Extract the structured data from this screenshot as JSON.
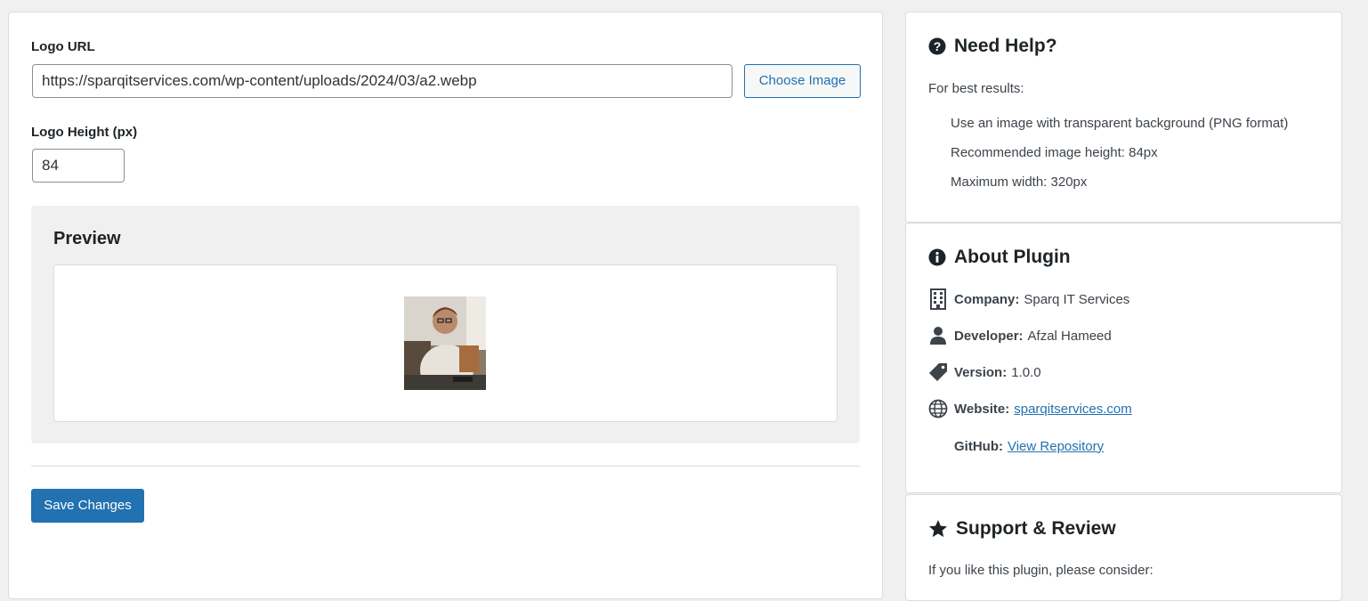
{
  "main": {
    "logo_url_label": "Logo URL",
    "logo_url_value": "https://sparqitservices.com/wp-content/uploads/2024/03/a2.webp",
    "choose_image_label": "Choose Image",
    "logo_height_label": "Logo Height (px)",
    "logo_height_value": "84",
    "preview_title": "Preview",
    "save_label": "Save Changes"
  },
  "help": {
    "title": "Need Help?",
    "icon": "question-circle-icon",
    "intro": "For best results:",
    "tips": [
      "Use an image with transparent background (PNG format)",
      "Recommended image height: 84px",
      "Maximum width: 320px"
    ]
  },
  "about": {
    "title": "About Plugin",
    "icon": "info-circle-icon",
    "company_label": "Company:",
    "company_value": "Sparq IT Services",
    "developer_label": "Developer:",
    "developer_value": "Afzal Hameed",
    "version_label": "Version:",
    "version_value": "1.0.0",
    "website_label": "Website:",
    "website_value": "sparqitservices.com",
    "github_label": "GitHub:",
    "github_value": "View Repository"
  },
  "support": {
    "title": "Support & Review",
    "icon": "star-icon",
    "intro": "If you like this plugin, please consider:"
  },
  "colors": {
    "accent": "#2271b1",
    "background": "#f0f0f1",
    "text": "#1d2327"
  }
}
